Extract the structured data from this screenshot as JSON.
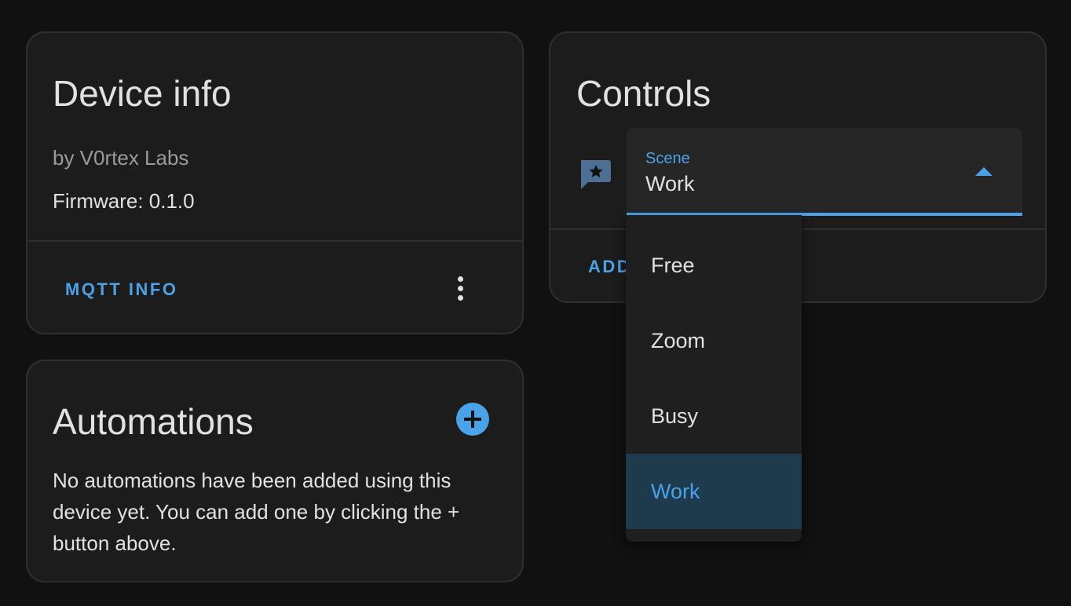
{
  "device_info": {
    "title": "Device info",
    "manufacturer": "by V0rtex Labs",
    "firmware": "Firmware: 0.1.0",
    "mqtt_button": "MQTT INFO",
    "menu_icon": "dots-vertical-icon"
  },
  "automations": {
    "title": "Automations",
    "add_icon": "plus-circle-icon",
    "description": "No automations have been added using this device yet. You can add one by clicking the + button above."
  },
  "controls": {
    "title": "Controls",
    "scene_icon": "message-star-icon",
    "scene": {
      "label": "Scene",
      "value": "Work",
      "options": [
        "Free",
        "Zoom",
        "Busy",
        "Work"
      ],
      "selected_index": 3
    },
    "add_button": "ADD"
  },
  "colors": {
    "background": "#111111",
    "card": "#1c1c1c",
    "accent": "#4aa3e8",
    "selected_bg": "#1e3a4d",
    "icon": "#4d6f94"
  }
}
